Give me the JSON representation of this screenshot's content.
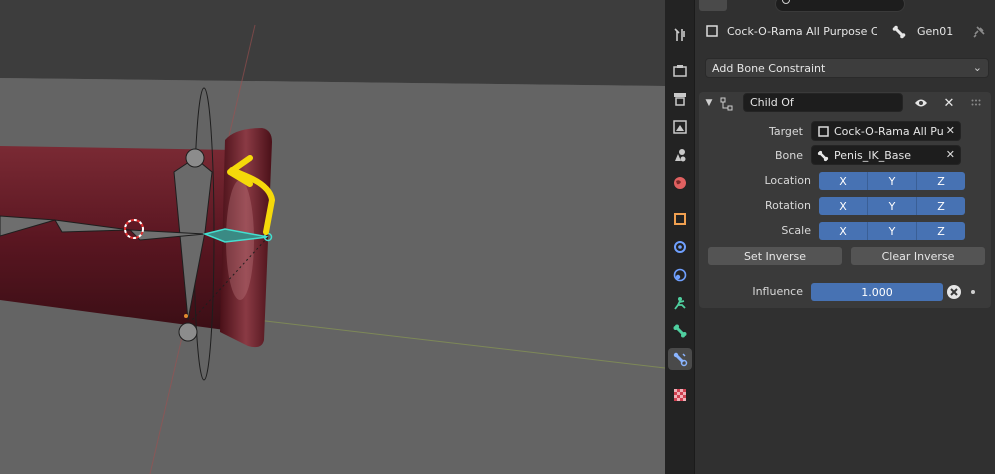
{
  "header": {
    "object_name": "Cock-O-Rama All Purpose C...",
    "bone_name": "Gen01"
  },
  "add_constraint": {
    "label": "Add Bone Constraint"
  },
  "constraint": {
    "name": "Child Of",
    "target_label": "Target",
    "target_value": "Cock-O-Rama All Pu...",
    "bone_label": "Bone",
    "bone_value": "Penis_IK_Base",
    "location_label": "Location",
    "rotation_label": "Rotation",
    "scale_label": "Scale",
    "axes": [
      "X",
      "Y",
      "Z"
    ],
    "set_inverse": "Set Inverse",
    "clear_inverse": "Clear Inverse",
    "influence_label": "Influence",
    "influence_value": "1.000"
  },
  "tabs": [
    {
      "name": "tool-icon",
      "color": "#c9c9c9"
    },
    {
      "name": "render-icon",
      "color": "#c9c9c9"
    },
    {
      "name": "output-icon",
      "color": "#c9c9c9"
    },
    {
      "name": "view-layer-icon",
      "color": "#c9c9c9"
    },
    {
      "name": "scene-icon",
      "color": "#c9c9c9"
    },
    {
      "name": "world-icon",
      "color": "#e06060"
    },
    {
      "name": "object-icon",
      "color": "#f0a050"
    },
    {
      "name": "modifiers-icon",
      "color": "#6fa0ff"
    },
    {
      "name": "physics-icon",
      "color": "#6fa0ff"
    },
    {
      "name": "object-constraints-icon",
      "color": "#4fcf9f"
    },
    {
      "name": "bone-icon",
      "color": "#4fcf9f"
    },
    {
      "name": "bone-constraints-icon",
      "color": "#8ab4ff"
    },
    {
      "name": "texture-icon",
      "color": "#d04050"
    }
  ],
  "colors": {
    "accent": "#4772b3",
    "panel_bg": "#303030",
    "viewport_bg": "#5c5c5c",
    "annotation_arrow": "#f5d90a",
    "selected_bone": "#43e0d0"
  }
}
